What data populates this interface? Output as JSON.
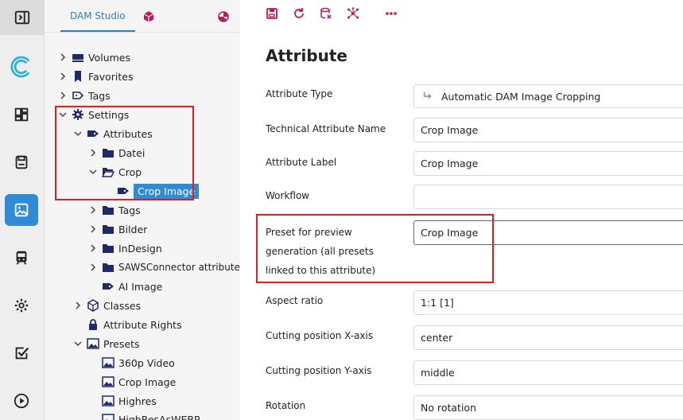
{
  "rail": {
    "items": [
      {
        "name": "toggle-sidebar-icon"
      },
      {
        "name": "brand-logo-icon"
      },
      {
        "name": "dashboard-icon"
      },
      {
        "name": "save-icon"
      },
      {
        "name": "image-icon"
      },
      {
        "name": "train-icon"
      },
      {
        "name": "gear-icon"
      },
      {
        "name": "checkbox-icon"
      },
      {
        "name": "play-icon"
      }
    ],
    "accent": "#2f8bd6"
  },
  "tree": {
    "tab_label": "DAM Studio",
    "nodes": [
      {
        "label": "Volumes"
      },
      {
        "label": "Favorites"
      },
      {
        "label": "Tags"
      },
      {
        "label": "Settings"
      },
      {
        "label": "Attributes"
      },
      {
        "label": "Datei"
      },
      {
        "label": "Crop"
      },
      {
        "label": "Crop Image"
      },
      {
        "label": "Tags"
      },
      {
        "label": "Bilder"
      },
      {
        "label": "InDesign"
      },
      {
        "label": "SAWSConnector attributes"
      },
      {
        "label": "AI Image"
      },
      {
        "label": "Classes"
      },
      {
        "label": "Attribute Rights"
      },
      {
        "label": "Presets"
      },
      {
        "label": "360p Video"
      },
      {
        "label": "Crop Image"
      },
      {
        "label": "Highres"
      },
      {
        "label": "HighResAsWEBP"
      }
    ]
  },
  "main": {
    "title": "Attribute",
    "fields": [
      {
        "label": "Attribute Type",
        "value": "Automatic DAM Image Cropping"
      },
      {
        "label": "Technical Attribute Name",
        "value": "Crop Image"
      },
      {
        "label": "Attribute Label",
        "value": "Crop Image"
      },
      {
        "label": "Workflow",
        "value": ""
      },
      {
        "label": "Preset for preview generation (all presets linked to this attribute)",
        "value": "Crop Image"
      },
      {
        "label": "Aspect ratio",
        "value": "1:1 [1]"
      },
      {
        "label": "Cutting position X-axis",
        "value": "center"
      },
      {
        "label": "Cutting position Y-axis",
        "value": "middle"
      },
      {
        "label": "Rotation",
        "value": "No rotation"
      }
    ]
  },
  "colors": {
    "highlight_box": "#e02020",
    "toolbar_icon": "#c0185a",
    "tree_icon": "#1f2a6b"
  }
}
